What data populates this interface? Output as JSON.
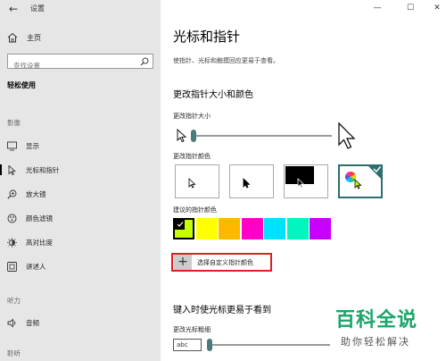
{
  "app_title": "设置",
  "sidebar": {
    "home_label": "主页",
    "search_placeholder": "查找设置",
    "heading": "轻松使用",
    "groups": [
      {
        "label": "影像",
        "items": [
          "显示",
          "光标和指针",
          "放大镜",
          "颜色滤镜",
          "高对比度",
          "讲述人"
        ]
      },
      {
        "label": "听力",
        "items": [
          "音频"
        ]
      },
      {
        "label": "聆听"
      }
    ],
    "active_item": "光标和指针"
  },
  "main": {
    "title": "光标和指针",
    "description": "使指针、光标和触摸回应更易于查看。",
    "section_pointer": "更改指针大小和颜色",
    "size_label": "更改指针大小",
    "size_level": 1,
    "color_label": "更改指针颜色",
    "color_options": [
      "white",
      "black",
      "inverted",
      "custom"
    ],
    "selected_color_option": "custom",
    "suggested_label": "建议的指针颜色",
    "suggested_colors": [
      "#c8ff00",
      "#ffff00",
      "#ffb800",
      "#ff00c8",
      "#00e0ff",
      "#00f5c0",
      "#c800ff"
    ],
    "custom_color_label": "选择自定义指针颜色",
    "section_cursor": "键入时使光标更易于看到",
    "cursor_thickness_label": "更改光标粗细",
    "cursor_preview_text": "abc",
    "cursor_thickness_level": 0
  },
  "watermark": {
    "title": "百科全说",
    "subtitle": "助你轻松解决"
  },
  "colors": {
    "accent": "#2d6e6e",
    "highlight_border": "#e02020",
    "sidebar_bg": "#e6e6e6"
  }
}
